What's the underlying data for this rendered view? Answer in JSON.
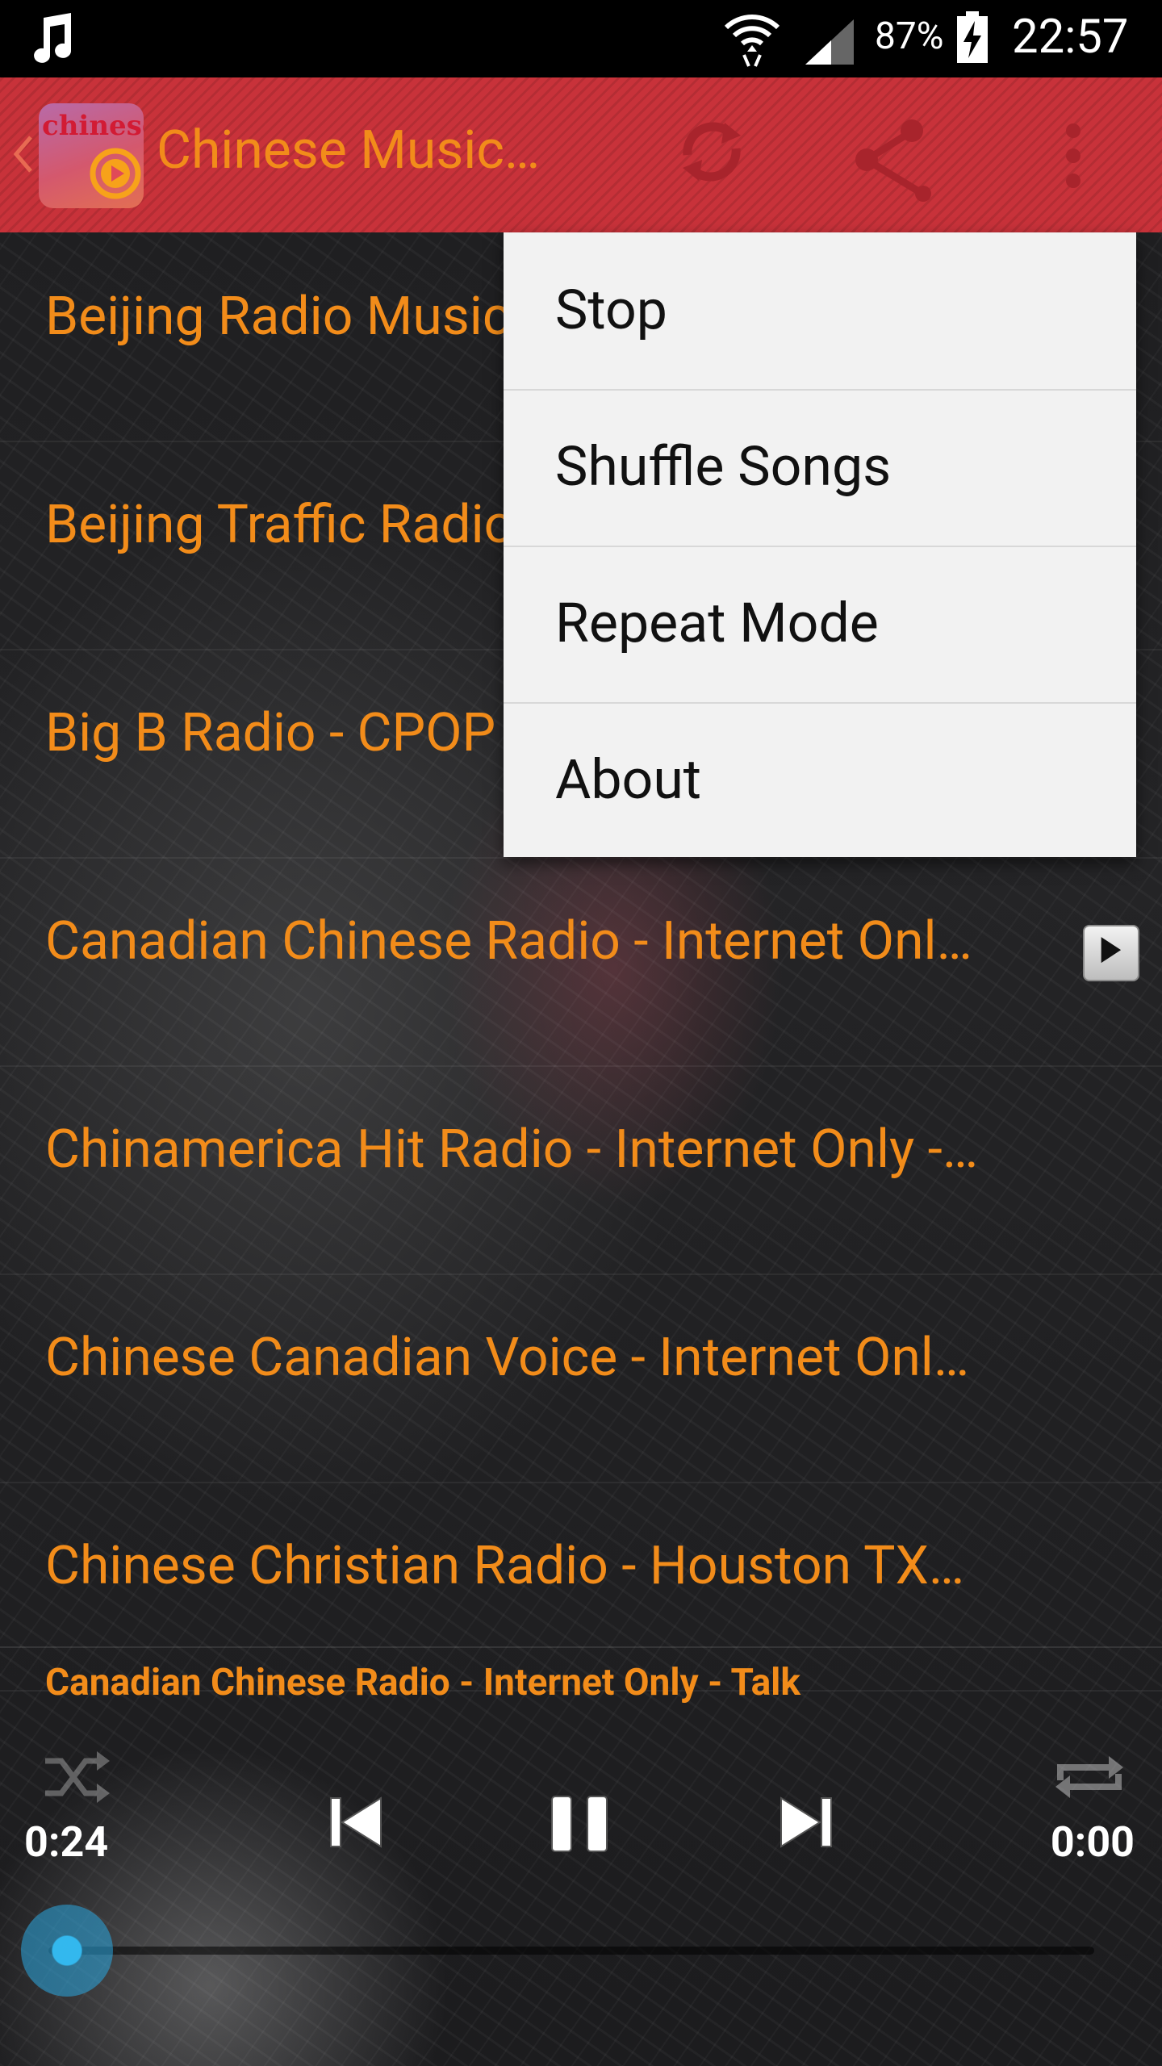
{
  "status_bar": {
    "battery": "87%",
    "time": "22:57",
    "icons": [
      "music-note-icon",
      "wifi-icon",
      "signal-icon",
      "battery-charging-icon"
    ]
  },
  "action_bar": {
    "title": "Chinese Music…",
    "app_icon_text": "chinese",
    "actions": [
      "refresh-icon",
      "share-icon",
      "overflow-menu-icon"
    ],
    "background_color": "#c8323a"
  },
  "stations": [
    {
      "label": "Beijing Radio Music"
    },
    {
      "label": "Beijing Traffic Radio"
    },
    {
      "label": "Big B Radio - CPOP"
    },
    {
      "label": "Canadian Chinese Radio - Internet Onl…"
    },
    {
      "label": "Chinamerica Hit Radio - Internet Only -…"
    },
    {
      "label": "Chinese Canadian Voice - Internet Onl…"
    },
    {
      "label": "Chinese Christian Radio - Houston TX…"
    }
  ],
  "overflow_menu": {
    "items": [
      "Stop",
      "Shuffle Songs",
      "Repeat Mode",
      "About"
    ]
  },
  "player": {
    "now_playing": "Canadian Chinese Radio - Internet Only - Talk",
    "elapsed": "0:24",
    "total": "0:00",
    "progress_fraction": 0.0,
    "accent_color": "#2aa7e0"
  },
  "colors": {
    "accent_text": "#f28c1a",
    "menu_bg": "#f2f2f2"
  }
}
